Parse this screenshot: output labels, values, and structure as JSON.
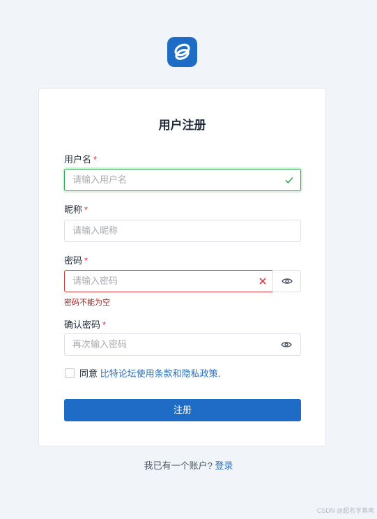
{
  "form": {
    "title": "用户注册",
    "required_mark": "*",
    "fields": [
      {
        "label": "用户名",
        "placeholder": "请输入用户名",
        "state": "valid",
        "icon": "check-icon"
      },
      {
        "label": "昵称",
        "placeholder": "请输入昵称",
        "state": "default"
      },
      {
        "label": "密码",
        "placeholder": "请输入密码",
        "state": "error",
        "icon": "clear-icon",
        "addon_icon": "eye-icon",
        "error": "密码不能为空"
      },
      {
        "label": "确认密码",
        "placeholder": "再次输入密码",
        "state": "default",
        "icon": "eye-icon"
      }
    ],
    "agree_prefix": "同意",
    "agree_link": "比特论坛使用条款和隐私政策",
    "agree_suffix": ".",
    "submit_label": "注册"
  },
  "footer": {
    "text": "我已有一个账户?",
    "link": "登录"
  },
  "watermark": "CSDN @起名字真南",
  "colors": {
    "primary": "#1f6cc6",
    "success": "#36a853",
    "error": "#d9393f",
    "link": "#2f6fb8",
    "background": "#f1f4f9"
  }
}
